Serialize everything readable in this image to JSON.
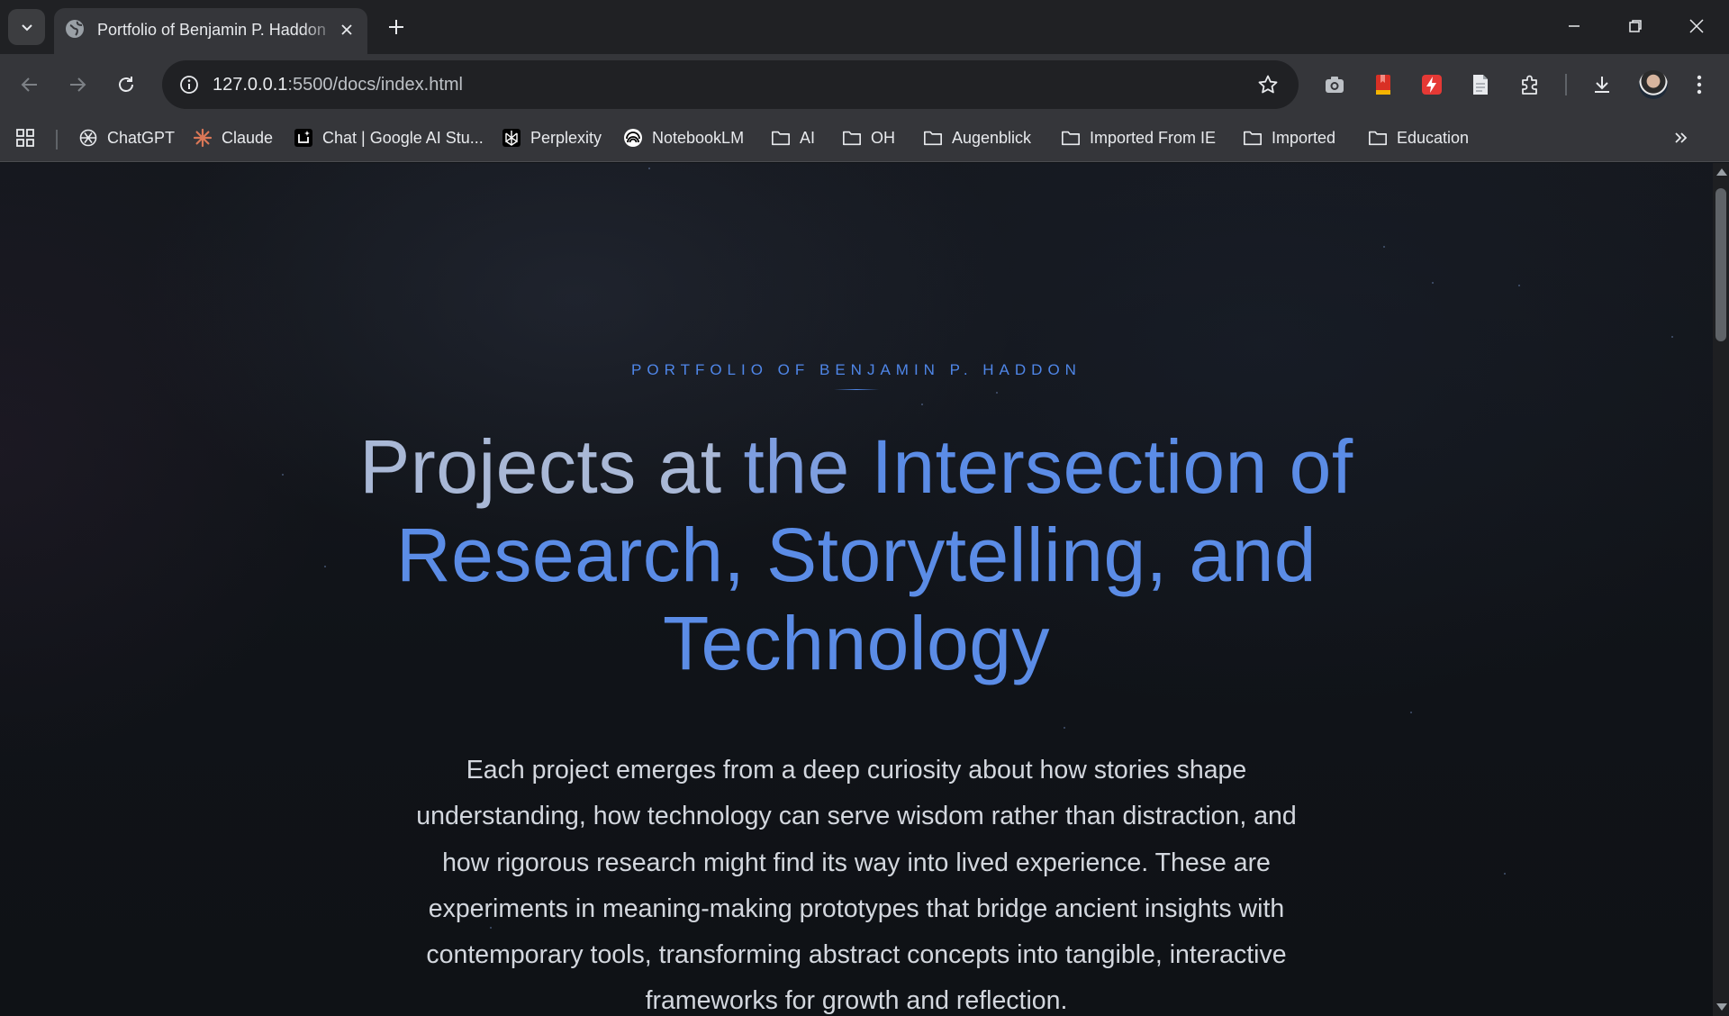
{
  "browser": {
    "tab": {
      "title": "Portfolio of Benjamin P. Haddon"
    },
    "address_bar": {
      "host": "127.0.0.1",
      "path": ":5500/docs/index.html"
    },
    "bookmarks": [
      {
        "label": "ChatGPT",
        "icon": "chatgpt-icon"
      },
      {
        "label": "Claude",
        "icon": "claude-icon"
      },
      {
        "label": "Chat | Google AI Stu...",
        "icon": "google-ai-studio-icon"
      },
      {
        "label": "Perplexity",
        "icon": "perplexity-icon"
      },
      {
        "label": "NotebookLM",
        "icon": "notebooklm-icon"
      },
      {
        "label": "AI",
        "icon": "folder-icon"
      },
      {
        "label": "OH",
        "icon": "folder-icon"
      },
      {
        "label": "Augenblick",
        "icon": "folder-icon"
      },
      {
        "label": "Imported From IE",
        "icon": "folder-icon"
      },
      {
        "label": "Imported",
        "icon": "folder-icon"
      },
      {
        "label": "Education",
        "icon": "folder-icon"
      }
    ],
    "colors": {
      "tabstrip": "#202124",
      "toolbar": "#35363a",
      "omnibox": "#202124"
    }
  },
  "page": {
    "eyebrow": "PORTFOLIO OF BENJAMIN P. HADDON",
    "title_words": [
      "Projects",
      "at",
      "the",
      "Intersection",
      "of",
      "Research,",
      "Storytelling,",
      "and",
      "Technology"
    ],
    "intro": "Each project emerges from a deep curiosity about how stories shape understanding, how technology can serve wisdom rather than distraction, and how rigorous research might find its way into lived experience. These are experiments in meaning-making prototypes that bridge ancient insights with contemporary tools, transforming abstract concepts into tangible, interactive frameworks for growth and reflection.",
    "colors": {
      "accent": "#4f86e8",
      "title": "#5b8ce6",
      "background": "#0f1216",
      "body_text": "#d3d7de"
    }
  }
}
